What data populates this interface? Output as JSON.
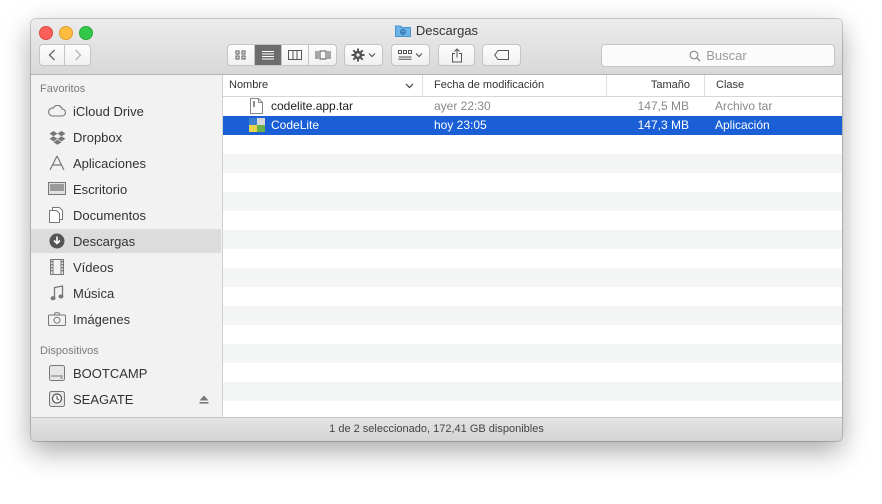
{
  "window": {
    "title": "Descargas"
  },
  "toolbar": {
    "back": "back",
    "forward": "forward",
    "search_placeholder": "Buscar"
  },
  "sidebar": {
    "favorites_header": "Favoritos",
    "favorites": [
      {
        "label": "iCloud Drive",
        "icon": "cloud-icon"
      },
      {
        "label": "Dropbox",
        "icon": "dropbox-icon"
      },
      {
        "label": "Aplicaciones",
        "icon": "applications-icon"
      },
      {
        "label": "Escritorio",
        "icon": "desktop-icon"
      },
      {
        "label": "Documentos",
        "icon": "documents-icon"
      },
      {
        "label": "Descargas",
        "icon": "download-icon",
        "selected": true
      },
      {
        "label": "Vídeos",
        "icon": "film-icon"
      },
      {
        "label": "Música",
        "icon": "music-icon"
      },
      {
        "label": "Imágenes",
        "icon": "camera-icon"
      }
    ],
    "devices_header": "Dispositivos",
    "devices": [
      {
        "label": "BOOTCAMP",
        "icon": "disk-icon"
      },
      {
        "label": "SEAGATE",
        "icon": "time-machine-disk-icon",
        "ejectable": true
      }
    ]
  },
  "columns": {
    "name": "Nombre",
    "modified": "Fecha de modificación",
    "size": "Tamaño",
    "kind": "Clase"
  },
  "files": [
    {
      "name": "codelite.app.tar",
      "modified": "ayer 22:30",
      "size": "147,5 MB",
      "kind": "Archivo tar",
      "selected": false
    },
    {
      "name": "CodeLite",
      "modified": "hoy 23:05",
      "size": "147,3 MB",
      "kind": "Aplicación",
      "selected": true
    }
  ],
  "status": {
    "text": "1 de 2 seleccionado, 172,41 GB disponibles"
  },
  "colors": {
    "selection": "#1a5fd6",
    "sidebar_bg": "#f2f2f2"
  }
}
